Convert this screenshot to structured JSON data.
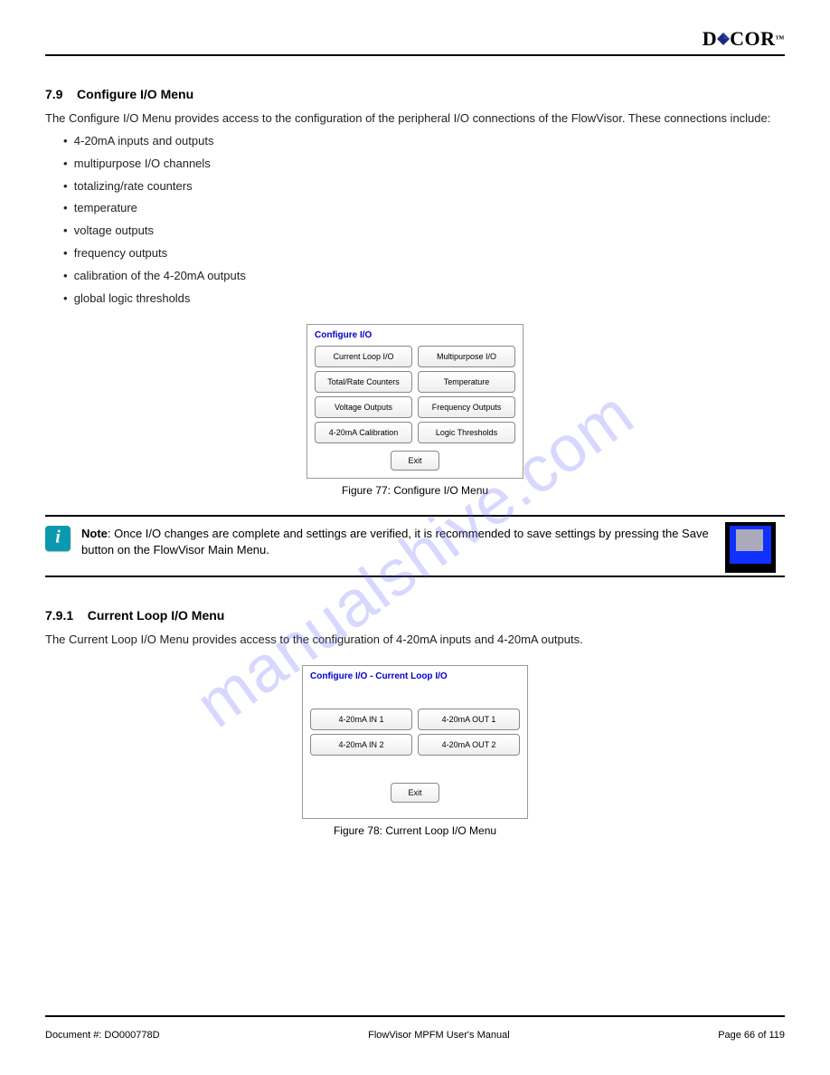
{
  "header": {
    "brand": "DYCOR",
    "brand_tm": "™"
  },
  "watermark": "manualshive.com",
  "sections": {
    "s1": {
      "num": "7.9",
      "title": "Configure I/O Menu",
      "p1": "The Configure I/O Menu provides access to the configuration of the peripheral I/O connections of the FlowVisor. These connections include:",
      "bullets": [
        "4-20mA inputs and outputs",
        "multipurpose I/O channels",
        "totalizing/rate counters",
        "temperature",
        "voltage outputs",
        "frequency outputs",
        "calibration of the 4-20mA outputs",
        "global logic thresholds"
      ],
      "fig_caption": "Figure 77: Configure I/O Menu"
    },
    "note": {
      "label": "Note",
      "text": "Once I/O changes are complete and settings are verified, it is recommended to save settings by pressing the Save button on the FlowVisor Main Menu."
    },
    "s2": {
      "num": "7.9.1",
      "title": "Current Loop I/O Menu",
      "p1": "The Current Loop I/O Menu provides access to the configuration of 4-20mA inputs and 4-20mA outputs.",
      "fig_caption": "Figure 78: Current Loop I/O Menu"
    }
  },
  "dialog1": {
    "title": "Configure I/O",
    "buttons": [
      "Current Loop I/O",
      "Multipurpose I/O",
      "Total/Rate Counters",
      "Temperature",
      "Voltage Outputs",
      "Frequency Outputs",
      "4-20mA Calibration",
      "Logic Thresholds"
    ],
    "exit": "Exit"
  },
  "dialog2": {
    "title": "Configure I/O - Current Loop I/O",
    "buttons": [
      "4-20mA IN 1",
      "4-20mA OUT 1",
      "4-20mA IN 2",
      "4-20mA OUT 2"
    ],
    "exit": "Exit"
  },
  "footer": {
    "left": "Document #: DO000778D",
    "center": "FlowVisor MPFM User's Manual",
    "right": "Page 66 of 119"
  }
}
